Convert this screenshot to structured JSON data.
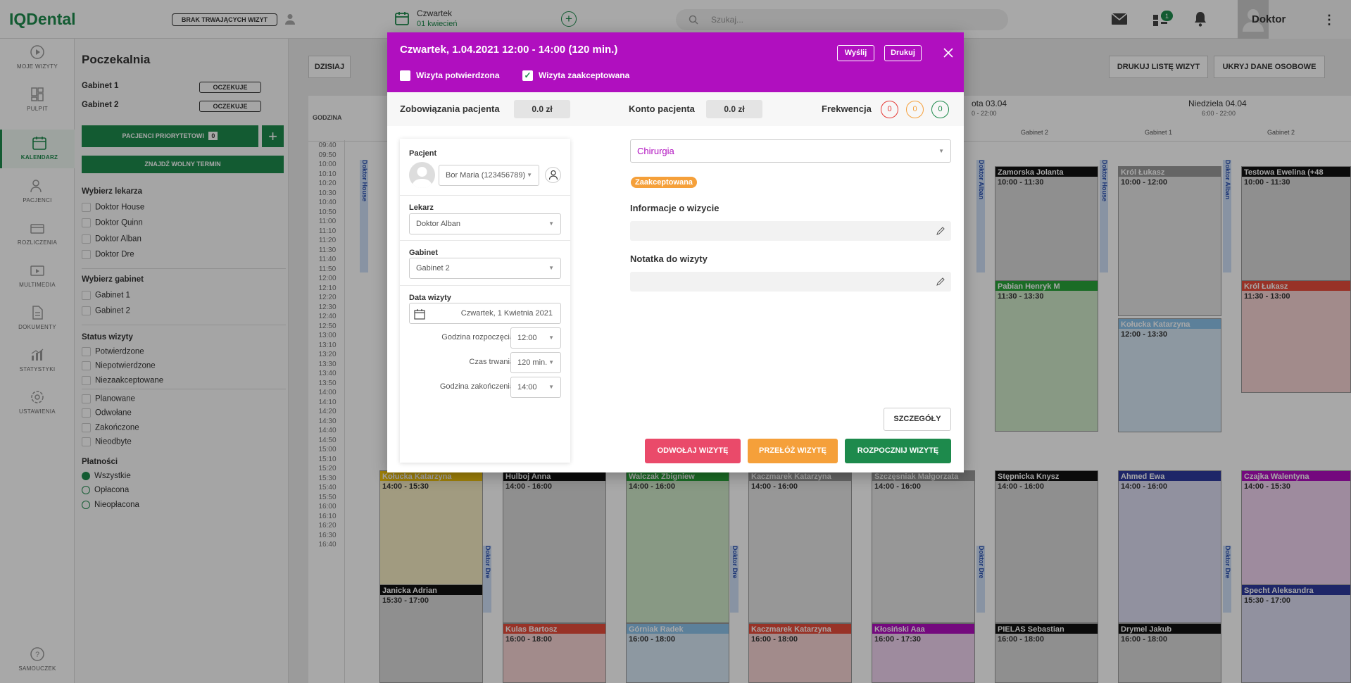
{
  "app": {
    "logo": "IQDental"
  },
  "topbar": {
    "no_visits_badge": "BRAK TRWAJĄCYCH WIZYT",
    "date_day": "Czwartek",
    "date_value": "01 kwiecień",
    "search_placeholder": "Szukaj...",
    "notif_count": "1",
    "user_name": "Doktor"
  },
  "nav": [
    {
      "label": "MOJE WIZYTY",
      "icon": "play-circle-icon"
    },
    {
      "label": "PULPIT",
      "icon": "dashboard-icon"
    },
    {
      "label": "KALENDARZ",
      "icon": "calendar-icon"
    },
    {
      "label": "PACJENCI",
      "icon": "patients-icon"
    },
    {
      "label": "ROZLICZENIA",
      "icon": "wallet-icon"
    },
    {
      "label": "MULTIMEDIA",
      "icon": "multimedia-icon"
    },
    {
      "label": "DOKUMENTY",
      "icon": "document-icon"
    },
    {
      "label": "STATYSTYKI",
      "icon": "chart-icon"
    },
    {
      "label": "USTAWIENIA",
      "icon": "gear-icon"
    },
    {
      "label": "SAMOUCZEK",
      "icon": "help-icon"
    }
  ],
  "sidebar": {
    "title": "Poczekalnia",
    "rooms": [
      {
        "name": "Gabinet 1",
        "status": "OCZEKUJE"
      },
      {
        "name": "Gabinet 2",
        "status": "OCZEKUJE"
      }
    ],
    "priority_btn": "PACJENCI PRIORYTETOWI",
    "priority_count": "0",
    "find_slot_btn": "ZNAJDŹ WOLNY TERMIN",
    "doctors_title": "Wybierz lekarza",
    "doctors": [
      "Doktor House",
      "Doktor Quinn",
      "Doktor Alban",
      "Doktor Dre"
    ],
    "cabinets_title": "Wybierz gabinet",
    "cabinets": [
      "Gabinet 1",
      "Gabinet 2"
    ],
    "status_title": "Status wizyty",
    "status_a": [
      "Potwierdzone",
      "Niepotwierdzone",
      "Niezaakceptowane"
    ],
    "status_b": [
      "Planowane",
      "Odwołane",
      "Zakończone",
      "Nieodbyte"
    ],
    "payments_title": "Płatności",
    "payments": [
      "Wszystkie",
      "Opłacona",
      "Nieopłacona"
    ]
  },
  "calendar": {
    "today_btn": "DZISIAJ",
    "print_btn": "DRUKUJ LISTĘ WIZYT",
    "hide_btn": "UKRYJ DANE OSOBOWE",
    "hour_col": "GODZINA",
    "day3_title": "ota 03.04",
    "day3_hours": "0 - 22:00",
    "day4_title": "Niedziela 04.04",
    "day4_hours": "6:00 - 22:00",
    "col_g2a": "Gabinet 2",
    "col_g1": "Gabinet 1",
    "col_g2b": "Gabinet 2",
    "hours": [
      "09:40",
      "09:50",
      "10:00",
      "10:10",
      "10:20",
      "10:30",
      "10:40",
      "10:50",
      "11:00",
      "11:10",
      "11:20",
      "11:30",
      "11:40",
      "11:50",
      "12:00",
      "12:10",
      "12:20",
      "12:30",
      "12:40",
      "12:50",
      "13:00",
      "13:10",
      "13:20",
      "13:30",
      "13:40",
      "13:50",
      "14:00",
      "14:10",
      "14:20",
      "14:30",
      "14:40",
      "14:50",
      "15:00",
      "15:10",
      "15:20",
      "15:30",
      "15:40",
      "15:50",
      "16:00",
      "16:10",
      "16:20",
      "16:30",
      "16:40"
    ],
    "lanes": [
      "Doktor House",
      "Doktor Alban",
      "Doktor House",
      "Doktor Alban",
      "Doktor Dre",
      "Doktor Dre",
      "Doktor Dre",
      "Doktor Dre"
    ],
    "appointments": [
      {
        "name": "Zamorska Jolanta",
        "time": "10:00 - 11:30"
      },
      {
        "name": "Pabian Henryk M",
        "time": "11:30 - 13:30"
      },
      {
        "name": "Król Łukasz",
        "time": "10:00 - 12:00"
      },
      {
        "name": "Kołucka Katarzyna",
        "time": "12:00 - 13:30"
      },
      {
        "name": "Testowa Ewelina (+48",
        "time": "10:00 - 11:30"
      },
      {
        "name": "Król Łukasz",
        "time": "11:30 - 13:00"
      },
      {
        "name": "Kołucka Katarzyna",
        "time": "14:00 - 15:30"
      },
      {
        "name": "Janicka Adrian",
        "time": "15:30 - 17:00"
      },
      {
        "name": "Hulboj Anna",
        "time": "14:00 - 16:00"
      },
      {
        "name": "Kulas Bartosz",
        "time": "16:00 - 18:00"
      },
      {
        "name": "Walczak Zbigniew",
        "time": "14:00 - 16:00"
      },
      {
        "name": "Górniak Radek",
        "time": "16:00 - 18:00"
      },
      {
        "name": "Kaczmarek Katarzyna",
        "time": "14:00 - 16:00"
      },
      {
        "name": "Kaczmarek Katarzyna",
        "time": "16:00 - 18:00"
      },
      {
        "name": "Szczęsniak Małgorzata",
        "time": "14:00 - 16:00"
      },
      {
        "name": "Kłosiński Aaa",
        "time": "16:00 - 17:30"
      },
      {
        "name": "Stępnicka Knysz",
        "time": "14:00 - 16:00"
      },
      {
        "name": "PIELAS Sebastian",
        "time": "16:00 - 18:00"
      },
      {
        "name": "Ahmed Ewa",
        "time": "14:00 - 16:00"
      },
      {
        "name": "Drymel Jakub",
        "time": "16:00 - 18:00"
      },
      {
        "name": "Czajka Walentyna",
        "time": "14:00 - 15:30"
      },
      {
        "name": "Specht Aleksandra",
        "time": "15:30 - 17:00"
      }
    ]
  },
  "modal": {
    "title": "Czwartek, 1.04.2021 12:00 - 14:00 (120 min.)",
    "send_btn": "Wyślij",
    "print_btn": "Drukuj",
    "confirmed_label": "Wizyta potwierdzona",
    "accepted_label": "Wizyta zaakceptowana",
    "liabilities_label": "Zobowiązania pacjenta",
    "liabilities_value": "0.0 zł",
    "account_label": "Konto pacjenta",
    "account_value": "0.0 zł",
    "attendance_label": "Frekwencja",
    "attendance": [
      "0",
      "0",
      "0"
    ],
    "patient_label": "Pacjent",
    "patient_value": "Bor Maria (123456789)",
    "doctor_label": "Lekarz",
    "doctor_value": "Doktor Alban",
    "cabinet_label": "Gabinet",
    "cabinet_value": "Gabinet 2",
    "date_label": "Data wizyty",
    "date_value": "Czwartek, 1 Kwietnia 2021",
    "start_label": "Godzina rozpoczęcia",
    "start_value": "12:00",
    "duration_label": "Czas trwania",
    "duration_value": "120 min.",
    "end_label": "Godzina zakończenia",
    "end_value": "14:00",
    "category_value": "Chirurgia",
    "status_badge": "Zaakceptowana",
    "info_label": "Informacje o wizycie",
    "note_label": "Notatka do wizyty",
    "details_btn": "SZCZEGÓŁY",
    "cancel_btn": "ODWOŁAJ WIZYTĘ",
    "reschedule_btn": "PRZEŁÓŻ WIZYTĘ",
    "start_btn": "ROZPOCZNIJ WIZYTĘ"
  },
  "colors": {
    "brand": "#1d8a4c",
    "modal_header": "#b00fbf",
    "cancel": "#ea4a6a",
    "reschedule": "#f5a03a",
    "start": "#1d8a4c",
    "badge": "#f5a03a"
  }
}
